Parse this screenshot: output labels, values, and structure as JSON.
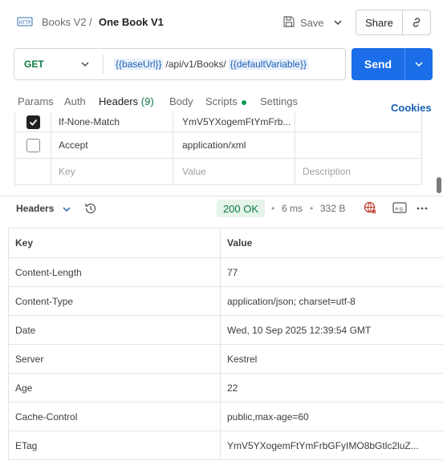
{
  "breadcrumb": {
    "parent": "Books V2",
    "separator": "/",
    "current": "One Book V1"
  },
  "toolbar": {
    "save_label": "Save",
    "share_label": "Share"
  },
  "request": {
    "method": "GET",
    "url_var1": "{{baseUrl}}",
    "url_path": "/api/v1/Books/",
    "url_var2": "{{defaultVariable}}",
    "send_label": "Send"
  },
  "tabs": {
    "params": "Params",
    "auth": "Auth",
    "headers": "Headers",
    "headers_count": "(9)",
    "body": "Body",
    "scripts": "Scripts",
    "settings": "Settings",
    "cookies": "Cookies"
  },
  "request_headers": [
    {
      "checked": true,
      "key": "If-None-Match",
      "value": "YmV5YXogemFtYmFrb..."
    },
    {
      "checked": false,
      "key": "Accept",
      "value": "application/xml"
    }
  ],
  "request_headers_placeholder": {
    "key": "Key",
    "value": "Value",
    "description": "Description"
  },
  "response": {
    "view_label": "Headers",
    "status": "200 OK",
    "time": "6 ms",
    "size": "332 B",
    "columns": {
      "key": "Key",
      "value": "Value"
    },
    "headers": [
      {
        "key": "Content-Length",
        "value": "77"
      },
      {
        "key": "Content-Type",
        "value": "application/json; charset=utf-8"
      },
      {
        "key": "Date",
        "value": "Wed, 10 Sep 2025 12:39:54 GMT"
      },
      {
        "key": "Server",
        "value": "Kestrel"
      },
      {
        "key": "Age",
        "value": "22"
      },
      {
        "key": "Cache-Control",
        "value": "public,max-age=60"
      },
      {
        "key": "ETag",
        "value": "YmV5YXogemFtYmFrbGFyIMO8bGtlc2luZ..."
      }
    ]
  },
  "colors": {
    "accent": "#1b6ee8",
    "method": "#0c7a43",
    "tab_underline": "#ff6c37"
  },
  "icons": [
    "http-icon",
    "save-icon",
    "chevron-down-icon",
    "link-icon",
    "history-icon",
    "globe-icon",
    "example-icon",
    "more-icon"
  ]
}
